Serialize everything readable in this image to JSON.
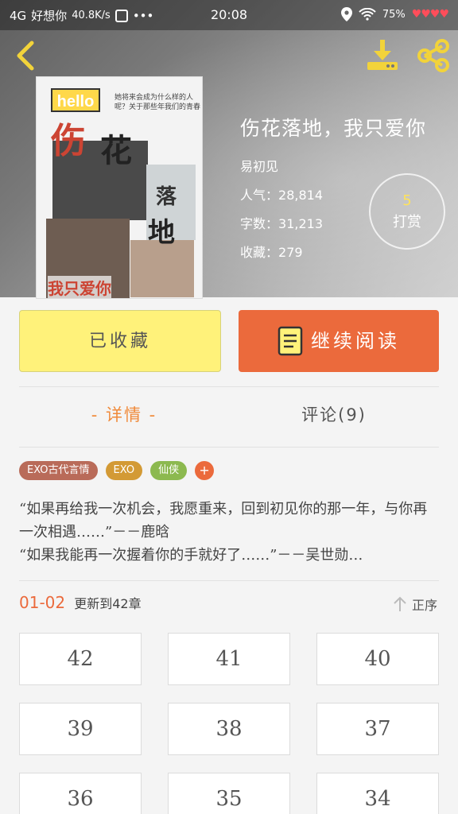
{
  "status_bar": {
    "network": "4G",
    "carrier": "好想你",
    "speed": "40.8K/s",
    "more": "•••",
    "time": "20:08",
    "battery": "75%",
    "hearts": "♥♥♥♥"
  },
  "book": {
    "title": "伤花落地，我只爱你",
    "author": "易初见",
    "popularity_label": "人气：",
    "popularity": "28,814",
    "words_label": "字数：",
    "words": "31,213",
    "favorites_label": "收藏：",
    "favorites": "279",
    "reward_count": "5",
    "reward_label": "打赏"
  },
  "cover": {
    "hello": "hello",
    "chars": [
      "伤",
      "花",
      "落",
      "地"
    ],
    "bottom": "我只爱你",
    "note": "她将来会成为什么样的人呢？关于那些年我们的青春"
  },
  "actions": {
    "favorited_label": "已收藏",
    "continue_label": "继续阅读"
  },
  "tabs": {
    "detail": "- 详情 -",
    "comments": "评论(9)"
  },
  "tags": [
    {
      "label": "EXO古代言情",
      "color": "#b96b59"
    },
    {
      "label": "EXO",
      "color": "#d39a35"
    },
    {
      "label": "仙侠",
      "color": "#8cb94f"
    }
  ],
  "tag_add": "+",
  "description": {
    "line1": "“如果再给我一次机会，我愿重来，回到初见你的那一年，与你再一次相遇……”－－鹿晗",
    "line2": "“如果我能再一次握着你的手就好了……”－－吴世勋…"
  },
  "update": {
    "date": "01-02",
    "text": "更新到42章",
    "sort_label": "正序"
  },
  "chapters": [
    "42",
    "41",
    "40",
    "39",
    "38",
    "37",
    "36",
    "35",
    "34"
  ],
  "colors": {
    "accent_orange": "#eb6a3c",
    "favorite_yellow": "#fff27a",
    "tab_active": "#f08a3a"
  }
}
